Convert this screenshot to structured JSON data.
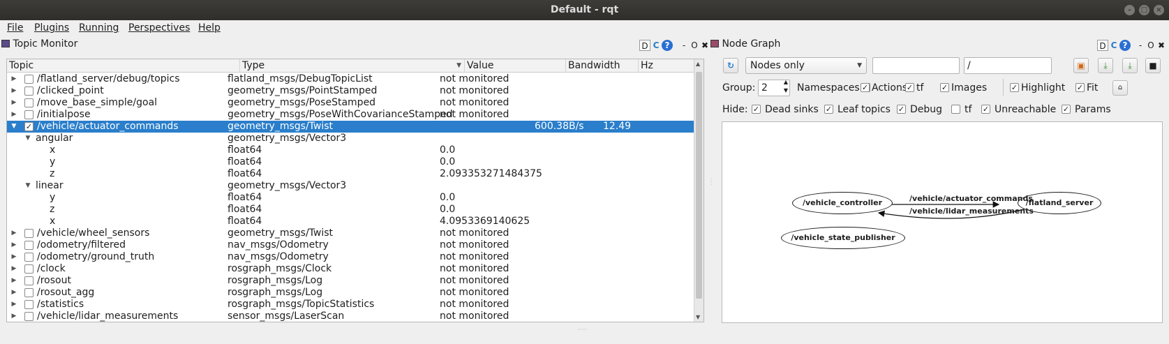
{
  "window": {
    "title": "Default - rqt"
  },
  "menu": [
    "File",
    "Plugins",
    "Running",
    "Perspectives",
    "Help"
  ],
  "topic_monitor": {
    "title": "Topic Monitor",
    "dock_buttons": [
      "D",
      "O",
      "✖"
    ],
    "columns": [
      "Topic",
      "Type",
      "Value",
      "Bandwidth",
      "Hz"
    ],
    "rows": [
      {
        "level": 0,
        "expander": "closed",
        "checkbox": true,
        "checked": false,
        "topic": "/flatland_server/debug/topics",
        "type": "flatland_msgs/DebugTopicList",
        "value": "not monitored",
        "bandwidth": "",
        "hz": ""
      },
      {
        "level": 0,
        "expander": "closed",
        "checkbox": true,
        "checked": false,
        "topic": "/clicked_point",
        "type": "geometry_msgs/PointStamped",
        "value": "not monitored",
        "bandwidth": "",
        "hz": ""
      },
      {
        "level": 0,
        "expander": "closed",
        "checkbox": true,
        "checked": false,
        "topic": "/move_base_simple/goal",
        "type": "geometry_msgs/PoseStamped",
        "value": "not monitored",
        "bandwidth": "",
        "hz": ""
      },
      {
        "level": 0,
        "expander": "closed",
        "checkbox": true,
        "checked": false,
        "topic": "/initialpose",
        "type": "geometry_msgs/PoseWithCovarianceStamped",
        "value": "not monitored",
        "bandwidth": "",
        "hz": ""
      },
      {
        "level": 0,
        "expander": "open",
        "checkbox": true,
        "checked": true,
        "selected": true,
        "topic": "/vehicle/actuator_commands",
        "type": "geometry_msgs/Twist",
        "value": "",
        "bandwidth": "600.38B/s",
        "hz": "12.49"
      },
      {
        "level": 1,
        "expander": "open",
        "checkbox": false,
        "topic": "angular",
        "type": "geometry_msgs/Vector3",
        "value": "",
        "bandwidth": "",
        "hz": ""
      },
      {
        "level": 2,
        "expander": "none",
        "checkbox": false,
        "topic": "x",
        "type": "float64",
        "value": "0.0",
        "bandwidth": "",
        "hz": ""
      },
      {
        "level": 2,
        "expander": "none",
        "checkbox": false,
        "topic": "y",
        "type": "float64",
        "value": "0.0",
        "bandwidth": "",
        "hz": ""
      },
      {
        "level": 2,
        "expander": "none",
        "checkbox": false,
        "topic": "z",
        "type": "float64",
        "value": "2.093353271484375",
        "bandwidth": "",
        "hz": ""
      },
      {
        "level": 1,
        "expander": "open",
        "checkbox": false,
        "topic": "linear",
        "type": "geometry_msgs/Vector3",
        "value": "",
        "bandwidth": "",
        "hz": ""
      },
      {
        "level": 2,
        "expander": "none",
        "checkbox": false,
        "topic": "y",
        "type": "float64",
        "value": "0.0",
        "bandwidth": "",
        "hz": ""
      },
      {
        "level": 2,
        "expander": "none",
        "checkbox": false,
        "topic": "z",
        "type": "float64",
        "value": "0.0",
        "bandwidth": "",
        "hz": ""
      },
      {
        "level": 2,
        "expander": "none",
        "checkbox": false,
        "topic": "x",
        "type": "float64",
        "value": "4.0953369140625",
        "bandwidth": "",
        "hz": ""
      },
      {
        "level": 0,
        "expander": "closed",
        "checkbox": true,
        "checked": false,
        "topic": "/vehicle/wheel_sensors",
        "type": "geometry_msgs/Twist",
        "value": "not monitored",
        "bandwidth": "",
        "hz": ""
      },
      {
        "level": 0,
        "expander": "closed",
        "checkbox": true,
        "checked": false,
        "topic": "/odometry/filtered",
        "type": "nav_msgs/Odometry",
        "value": "not monitored",
        "bandwidth": "",
        "hz": ""
      },
      {
        "level": 0,
        "expander": "closed",
        "checkbox": true,
        "checked": false,
        "topic": "/odometry/ground_truth",
        "type": "nav_msgs/Odometry",
        "value": "not monitored",
        "bandwidth": "",
        "hz": ""
      },
      {
        "level": 0,
        "expander": "closed",
        "checkbox": true,
        "checked": false,
        "topic": "/clock",
        "type": "rosgraph_msgs/Clock",
        "value": "not monitored",
        "bandwidth": "",
        "hz": ""
      },
      {
        "level": 0,
        "expander": "closed",
        "checkbox": true,
        "checked": false,
        "topic": "/rosout",
        "type": "rosgraph_msgs/Log",
        "value": "not monitored",
        "bandwidth": "",
        "hz": ""
      },
      {
        "level": 0,
        "expander": "closed",
        "checkbox": true,
        "checked": false,
        "topic": "/rosout_agg",
        "type": "rosgraph_msgs/Log",
        "value": "not monitored",
        "bandwidth": "",
        "hz": ""
      },
      {
        "level": 0,
        "expander": "closed",
        "checkbox": true,
        "checked": false,
        "topic": "/statistics",
        "type": "rosgraph_msgs/TopicStatistics",
        "value": "not monitored",
        "bandwidth": "",
        "hz": ""
      },
      {
        "level": 0,
        "expander": "closed",
        "checkbox": true,
        "checked": false,
        "topic": "/vehicle/lidar_measurements",
        "type": "sensor_msgs/LaserScan",
        "value": "not monitored",
        "bandwidth": "",
        "hz": ""
      }
    ]
  },
  "node_graph": {
    "title": "Node Graph",
    "dock_buttons": [
      "D",
      "O",
      "✖"
    ],
    "mode": "Nodes only",
    "filter": "",
    "topic_filter": "/",
    "group_label": "Group:",
    "group_value": "2",
    "options": [
      {
        "label": "Namespaces",
        "checked": true
      },
      {
        "label": "Actions",
        "checked": true
      },
      {
        "label": "tf",
        "checked": true
      },
      {
        "label": "Images",
        "checked": true
      },
      {
        "label": "Highlight",
        "checked": true
      },
      {
        "label": "Fit",
        "checked": true
      }
    ],
    "hide_label": "Hide:",
    "hide_options": [
      {
        "label": "Dead sinks",
        "checked": true
      },
      {
        "label": "Leaf topics",
        "checked": true
      },
      {
        "label": "Debug",
        "checked": true
      },
      {
        "label": "tf",
        "checked": false
      },
      {
        "label": "Unreachable",
        "checked": true
      },
      {
        "label": "Params",
        "checked": true
      }
    ],
    "nodes": [
      "/vehicle_controller",
      "/flatland_server",
      "/vehicle_state_publisher"
    ],
    "edges": [
      {
        "label": "/vehicle/actuator_commands",
        "from": "/vehicle_controller",
        "to": "/flatland_server"
      },
      {
        "label": "/vehicle/lidar_measurements",
        "from": "/flatland_server",
        "to": "/vehicle_controller"
      }
    ]
  },
  "colors": {
    "selection": "#2a7ecb",
    "titlebar": "#33322f",
    "panel_bg": "#efefef"
  }
}
